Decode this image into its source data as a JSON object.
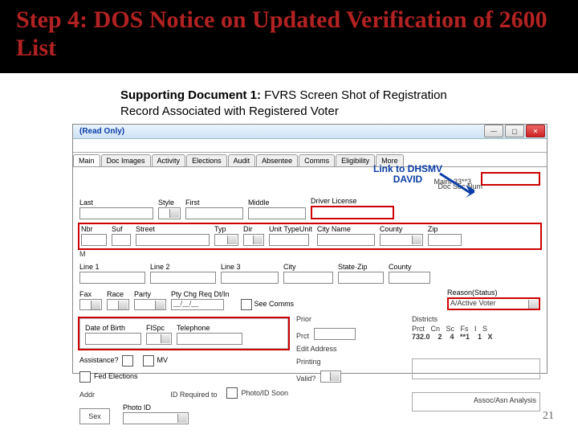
{
  "title": "Step 4: DOS Notice on Updated Verification of 2600 List",
  "caption_label": "Supporting Document 1:",
  "caption_rest": " FVRS Screen Shot of Registration Record Associated with Registered Voter",
  "readonly": "(Read Only)",
  "callout": "Link to DHSMV DAVID",
  "tabs": {
    "t0": "Main",
    "t1": "Doc Images",
    "t2": "Activity",
    "t3": "Elections",
    "t4": "Audit",
    "t5": "Absentee",
    "t6": "Comms",
    "t7": "Eligibility",
    "t8": "More"
  },
  "top": {
    "maint": "Maint 33**3",
    "doc": "Doc Sec Num"
  },
  "r1": {
    "last": "Last",
    "style": "Style",
    "first": "First",
    "middle": "Middle",
    "dl": "Driver License"
  },
  "r2": {
    "nbr": "Nbr",
    "suf": "Suf",
    "street": "Street",
    "typ": "Typ",
    "dir": "Dir",
    "ut": "Unit TypeUnit",
    "city": "City Name",
    "county": "County",
    "zip": "Zip"
  },
  "r2b": {
    "m": "M"
  },
  "r3": {
    "l1": "Line 1",
    "l2": "Line 2",
    "l3": "Line 3",
    "city": "City",
    "sz": "State·Zip",
    "cnty": "County"
  },
  "r4": {
    "fax": "Fax",
    "race": "Race",
    "party": "Party",
    "pty": "Pty Chg Req Dt/In",
    "dateph": "__/__/__",
    "see": "See Comms",
    "reason": "Reason(Status)",
    "stat": "A/Active Voter"
  },
  "r5": {
    "dob": "Date of Birth",
    "flspc": "FlSpc",
    "tel": "Telephone"
  },
  "r6": {
    "assist": "Assistance?",
    "mv": "MV",
    "fed": "Fed Elections",
    "addr": "Addr",
    "idreq": "ID Required to",
    "photo": "Photo/ID Soon",
    "prior": "Prior",
    "prct": "Prct",
    "edit": "Edit Address",
    "printing": "Printing",
    "valid": "Valid?"
  },
  "dist": {
    "hdr": "Districts",
    "g1": "Prct   Cn   Sc   Fs   I   S",
    "g2": "732.0    2    4   **1    1   X"
  },
  "btn": {
    "sex": "Sex",
    "photoid": "Photo ID"
  },
  "footer": {
    "asn": "Assoc/Asn Analysis"
  },
  "page": "21"
}
